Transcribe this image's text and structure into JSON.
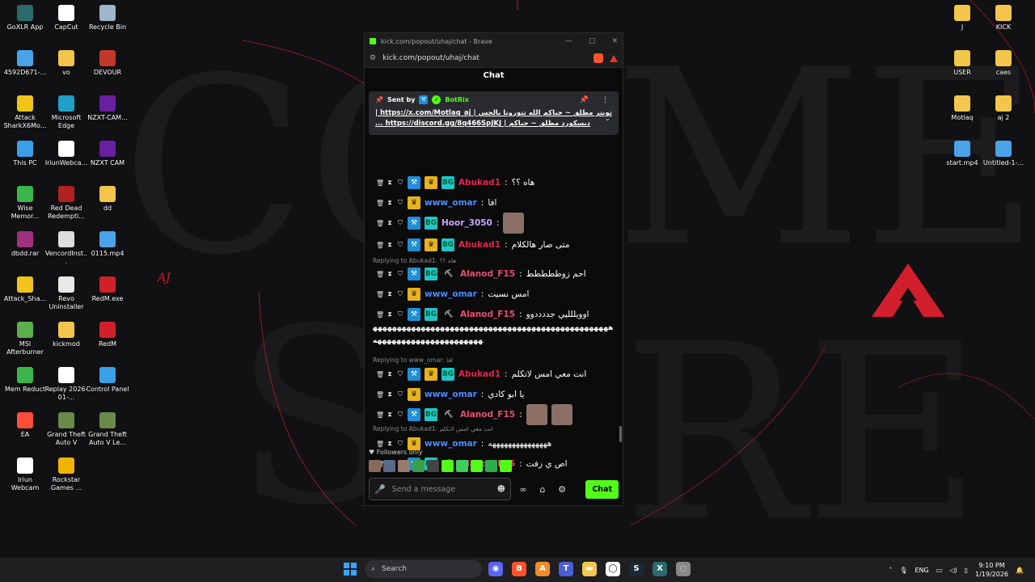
{
  "colors": {
    "kick_green": "#53fc18",
    "moderator_blue": "#1e8fd6",
    "crown_gold": "#e8b31a",
    "username_red": "#e0264a",
    "username_blue": "#4b8dff",
    "username_pink": "#e84d70",
    "username_lilac": "#c9a7ff"
  },
  "desktop_left": [
    {
      "label": "GoXLR App",
      "icon": "goxlr-icon",
      "color": "#2a6a6a"
    },
    {
      "label": "CapCut",
      "icon": "capcut-icon",
      "color": "#ffffff"
    },
    {
      "label": "Recycle Bin",
      "icon": "recycle-bin-icon",
      "color": "#9fb5c9"
    },
    {
      "label": "4592D671-...",
      "icon": "file-icon",
      "color": "#4aa3e8"
    },
    {
      "label": "vo",
      "icon": "folder-icon",
      "color": "#f3c64b"
    },
    {
      "label": "DEVOUR",
      "icon": "devour-icon",
      "color": "#c0392b"
    },
    {
      "label": "Attack SharkX6Mo...",
      "icon": "attack-shark-icon",
      "color": "#f0c419"
    },
    {
      "label": "Microsoft Edge",
      "icon": "edge-icon",
      "color": "#1fa0c8"
    },
    {
      "label": "NZXT-CAM...",
      "icon": "nzxt-icon",
      "color": "#6a1fa0"
    },
    {
      "label": "This PC",
      "icon": "this-pc-icon",
      "color": "#3aa0e8"
    },
    {
      "label": "IriunWebca...",
      "icon": "iriun-icon",
      "color": "#ffffff"
    },
    {
      "label": "NZXT CAM",
      "icon": "nzxt-icon",
      "color": "#6a1fa0"
    },
    {
      "label": "Wise Memor...",
      "icon": "wise-memory-icon",
      "color": "#3ab54a"
    },
    {
      "label": "Red Dead Redempti...",
      "icon": "rdr-icon",
      "color": "#b22222"
    },
    {
      "label": "dd",
      "icon": "folder-icon",
      "color": "#f3c64b"
    },
    {
      "label": "dbdd.rar",
      "icon": "rar-icon",
      "color": "#a03080"
    },
    {
      "label": "VencordInst...",
      "icon": "vencord-icon",
      "color": "#dddddd"
    },
    {
      "label": "0115.mp4",
      "icon": "video-file-icon",
      "color": "#4aa3e8"
    },
    {
      "label": "Attack_Sha...",
      "icon": "attack-shark-icon",
      "color": "#f0c419"
    },
    {
      "label": "Revo Uninstaller",
      "icon": "revo-icon",
      "color": "#e8e8e8"
    },
    {
      "label": "RedM.exe",
      "icon": "redm-icon",
      "color": "#d0202a"
    },
    {
      "label": "MSI Afterburner",
      "icon": "msi-afterburner-icon",
      "color": "#5ab04a"
    },
    {
      "label": "kickmod",
      "icon": "folder-icon",
      "color": "#f3c64b"
    },
    {
      "label": "RedM",
      "icon": "redm-icon",
      "color": "#d0202a"
    },
    {
      "label": "Mem Reduct",
      "icon": "mem-reduct-icon",
      "color": "#3ab54a"
    },
    {
      "label": "Replay 2026-01-...",
      "icon": "replay-file-icon",
      "color": "#ffffff"
    },
    {
      "label": "Control Panel",
      "icon": "control-panel-icon",
      "color": "#3aa0e8"
    },
    {
      "label": "EA",
      "icon": "ea-icon",
      "color": "#ff4d3a"
    },
    {
      "label": "Grand Theft Auto V",
      "icon": "gta-icon",
      "color": "#6a8a4a"
    },
    {
      "label": "Grand Theft Auto V Le...",
      "icon": "gta-icon",
      "color": "#6a8a4a"
    },
    {
      "label": "Iriun Webcam",
      "icon": "iriun-icon",
      "color": "#ffffff"
    },
    {
      "label": "Rockstar Games ...",
      "icon": "rockstar-icon",
      "color": "#f0b400"
    }
  ],
  "desktop_right": [
    {
      "label": "J",
      "icon": "folder-icon",
      "color": "#f3c64b"
    },
    {
      "label": "KICK",
      "icon": "folder-icon",
      "color": "#f3c64b"
    },
    {
      "label": "USER",
      "icon": "folder-icon",
      "color": "#f3c64b"
    },
    {
      "label": "caes",
      "icon": "folder-icon",
      "color": "#f3c64b"
    },
    {
      "label": "Motlaq",
      "icon": "folder-icon",
      "color": "#f3c64b"
    },
    {
      "label": "aj 2",
      "icon": "folder-icon",
      "color": "#f3c64b"
    },
    {
      "label": "start.mp4",
      "icon": "video-file-icon",
      "color": "#4aa3e8"
    },
    {
      "label": "Untitled-1-...",
      "icon": "video-file-icon",
      "color": "#4aa3e8"
    }
  ],
  "wallpaper": {
    "logo_text": "AJ"
  },
  "window": {
    "title": "kick.com/popout/uhaj/chat - Brave",
    "url": "kick.com/popout/uhaj/chat",
    "chat_header": "Chat"
  },
  "pinned": {
    "sent_by": "Sent by",
    "bot_name": "BotRix",
    "line1": "تويتر مطلق ~ حياكم الله تنورونا بالحس | https://x.com/Motlaq_aj |",
    "line2": "ديسكورد مطلق ~ حياكم | https://discord.gg/8q466SpJKJ ..."
  },
  "messages": [
    {
      "user": "Abukad1",
      "text": "هاه ؟؟",
      "color": "#e0264a",
      "badges": [
        "hammer",
        "crown",
        "bg"
      ]
    },
    {
      "user": "www_omar",
      "text": "افا",
      "color": "#4b8dff",
      "badges": [
        "crown"
      ]
    },
    {
      "user": "Hoor_3050",
      "text": "",
      "color": "#c9a7ff",
      "badges": [
        "hammer",
        "bg"
      ],
      "emotes": 1
    },
    {
      "user": "Abukad1",
      "text": "متى صار هالكلام",
      "color": "#e0264a",
      "badges": [
        "hammer",
        "crown",
        "bg"
      ]
    },
    {
      "reply": "Replying to Abukad1: هاه ؟؟"
    },
    {
      "user": "Alanod_F15",
      "text": "احم زوططططط",
      "color": "#e84d70",
      "badges": [
        "hammer",
        "bg",
        "pick"
      ]
    },
    {
      "user": "www_omar",
      "text": "امس نسيت",
      "color": "#4b8dff",
      "badges": [
        "crown"
      ]
    },
    {
      "user": "Alanod_F15",
      "text": "اوويللليي جددددوو",
      "color": "#e84d70",
      "badges": [
        "hammer",
        "bg",
        "pick"
      ]
    },
    {
      "long": "ههههههههههههههههههههههههههههههههههههههههههههههههههههههههههههههههههههههههه"
    },
    {
      "reply": "Replying to www_omar: افا"
    },
    {
      "user": "Abukad1",
      "text": "انت معي امس لاتكلم",
      "color": "#e0264a",
      "badges": [
        "hammer",
        "crown",
        "bg"
      ]
    },
    {
      "user": "www_omar",
      "text": "يا ابو كادي",
      "color": "#4b8dff",
      "badges": [
        "crown"
      ]
    },
    {
      "user": "Alanod_F15",
      "text": "",
      "color": "#e84d70",
      "badges": [
        "hammer",
        "bg",
        "pick"
      ],
      "emotes": 2
    },
    {
      "reply": "Replying to Abukad1: انت معي امس لاتكلم"
    },
    {
      "user": "www_omar",
      "text": "هههههههههههههههه",
      "color": "#4b8dff",
      "badges": [
        "crown"
      ]
    },
    {
      "user": "Alanod_F15",
      "text": "اص ي زفت",
      "color": "#e84d70",
      "badges": [
        "hammer",
        "bg",
        "pick"
      ]
    }
  ],
  "chat_footer": {
    "followers_only": "Followers only",
    "input_placeholder": "Send a message",
    "chat_button": "Chat"
  },
  "taskbar": {
    "search": "Search",
    "apps": [
      {
        "icon": "discord-icon",
        "color": "#5865f2",
        "glyph": "◉"
      },
      {
        "icon": "brave-icon",
        "color": "#fb542b",
        "glyph": "B"
      },
      {
        "icon": "aj-app-icon",
        "color": "#f08a24",
        "glyph": "A"
      },
      {
        "icon": "teams-icon",
        "color": "#4b5fd6",
        "glyph": "T"
      },
      {
        "icon": "file-explorer-icon",
        "color": "#f3c64b",
        "glyph": "▬"
      },
      {
        "icon": "iriun-icon",
        "color": "#ffffff",
        "glyph": "◯"
      },
      {
        "icon": "steam-icon",
        "color": "#1b2838",
        "glyph": "S"
      },
      {
        "icon": "goxlr-icon",
        "color": "#2a6a6a",
        "glyph": "X"
      },
      {
        "icon": "loader-icon",
        "color": "#888888",
        "glyph": "◌"
      }
    ],
    "lang": "ENG",
    "time": "9:10 PM",
    "date": "1/19/2026"
  }
}
